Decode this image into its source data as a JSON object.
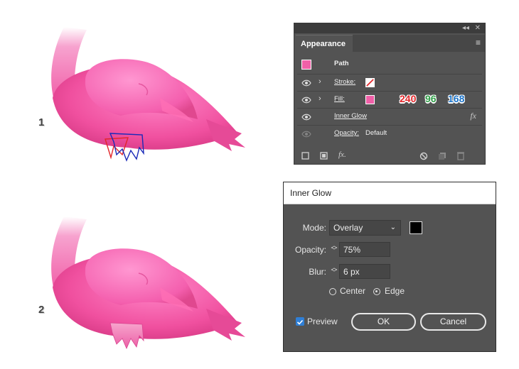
{
  "steps": {
    "one": "1",
    "two": "2"
  },
  "appearance_panel": {
    "window_controls": {
      "collapse": "◂◂",
      "close": "✕"
    },
    "tab_label": "Appearance",
    "menu_icon": "≡",
    "header_label": "Path",
    "rows": {
      "stroke": {
        "label": "Stroke:"
      },
      "fill": {
        "label": "Fill:",
        "r": "240",
        "g": "96",
        "b": "168"
      },
      "inner_glow": {
        "label": "Inner Glow",
        "fx": "fx"
      },
      "opacity": {
        "label": "Opacity:",
        "value": "Default"
      }
    },
    "fill_color": "#f060a8",
    "bottom_fx": "fx."
  },
  "inner_glow_dialog": {
    "title": "Inner Glow",
    "mode": {
      "label": "Mode:",
      "value": "Overlay"
    },
    "glow_color": "#000000",
    "opacity": {
      "label": "Opacity:",
      "value": "75%"
    },
    "blur": {
      "label": "Blur:",
      "value": "6 px"
    },
    "center_label": "Center",
    "edge_label": "Edge",
    "edge_selected": true,
    "preview_label": "Preview",
    "preview_checked": true,
    "ok_label": "OK",
    "cancel_label": "Cancel"
  },
  "colors": {
    "red": "#e3262a",
    "green": "#2e9d46",
    "blue": "#1a73c9",
    "panel_bg": "#535353"
  }
}
